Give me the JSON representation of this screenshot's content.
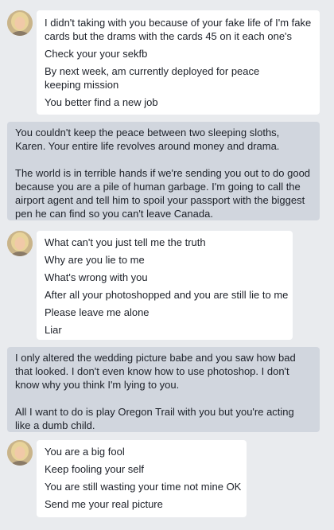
{
  "thread": {
    "group1": {
      "avatar_icon": "profile-photo",
      "lines": [
        "I didn't taking with you because of your fake life of I'm fake",
        "cards but the drams with the cards 45 on it each one's",
        "Check your your sekfb",
        "By next week, am currently deployed for peace",
        "keeping mission",
        "You better find a new job"
      ]
    },
    "reply1": {
      "paragraphs": [
        "You couldn't keep the peace between two sleeping sloths, Karen. Your entire life revolves around money and drama.",
        "The world is in terrible hands if we're sending you out to do good because you are a pile of human garbage. I'm going to call the airport agent and tell him to spoil your passport with the biggest pen he can find so you can't leave Canada."
      ]
    },
    "group2": {
      "avatar_icon": "profile-photo",
      "lines": [
        "What can't you just tell me the truth",
        "Why are you lie to me",
        "What's wrong with you",
        "After all your photoshopped and you are still lie to me",
        "Please leave me alone",
        "Liar"
      ]
    },
    "reply2": {
      "paragraphs": [
        "I only altered the wedding picture babe and you saw how bad that looked. I don't even know how to use photoshop. I don't know why you think I'm lying to you.",
        "All I want to do is play Oregon Trail with you but you're acting like a dumb child."
      ]
    },
    "group3": {
      "avatar_icon": "profile-photo",
      "lines": [
        "You are a big fool",
        "Keep fooling your self",
        "You are still wasting your time not mine OK",
        "Send me your real picture"
      ]
    }
  },
  "colors": {
    "background": "#e9ebee",
    "incoming_bubble": "#ffffff",
    "outgoing_bubble": "#d1d6de",
    "text": "#1d2129"
  }
}
